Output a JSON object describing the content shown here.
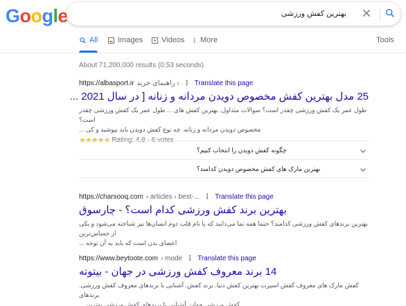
{
  "logo": {
    "letters": [
      "G",
      "o",
      "o",
      "g",
      "l",
      "e"
    ],
    "colors": [
      "#4285f4",
      "#ea4335",
      "#fbbc05",
      "#4285f4",
      "#34a853",
      "#ea4335"
    ]
  },
  "search": {
    "query": "بهترین کفش ورزشی"
  },
  "tabs": [
    {
      "label": "All",
      "icon": "search-icon"
    },
    {
      "label": "Images",
      "icon": "image-icon"
    },
    {
      "label": "Videos",
      "icon": "video-icon"
    },
    {
      "label": "More",
      "icon": "more-vert-icon"
    }
  ],
  "tools_label": "Tools",
  "stats": "About 71,200,000 results (0.53 seconds)",
  "results": [
    {
      "url": "https://albasport.ir",
      "path": "› راهنمای خرید",
      "translate": "Translate this page",
      "title": "25 مدل بهترین کفش مخصوص دویدن مردانه و زنانه [ در سال 2021 ...",
      "snippet_lines": [
        "طول عمر یک کفش ورزشی چقدر است؟ سوالات متداول. بهترین کفش های ... طول عمر یک کفش ورزشی چقدر است؟",
        "مخصوص دویدن مردانه و زنانه. چه نوع کفش دویدن باید بپوشید و کی ..."
      ],
      "stars": "★★★★★",
      "rating_text": "Rating: 4.8 · 6 votes"
    },
    {
      "url": "https://charsooq.com",
      "path": "› articles › best-...",
      "translate": "Translate this page",
      "title": "بهترین برند کفش ورزشی کدام است؟ - چارسوق",
      "snippet_lines": [
        "بهترین برندهای کفش ورزشی کدامند؟ حتما همه تما می‌دانید که پا نام قلب دوم انسان‌ها نیز شناخته می‌شود و یکی از حساس‌ترین",
        "اعضای بدن است که باید به آن توجه ..."
      ]
    },
    {
      "url": "https://www.beytoote.com",
      "path": "› mode",
      "translate": "Translate this page",
      "title": "14 برند معروف کفش ورزشی در جهان - بیتوته",
      "snippet_lines": [
        "کفش مارک های معروف کفش اسپرت بهترین کفش دنیا. برند کفش. آشنایی با برندهای معروف کفش ورزشی. برندهای",
        "کفش ورزشی جهان. آشنایی با برندهای کفش ورزشی بهترین ..."
      ]
    }
  ],
  "faqs": [
    "چگونه کفش دویدن را انتخاب کنیم؟",
    "بهترین مارک های کفش مخصوص دویدن کدامند؟"
  ]
}
